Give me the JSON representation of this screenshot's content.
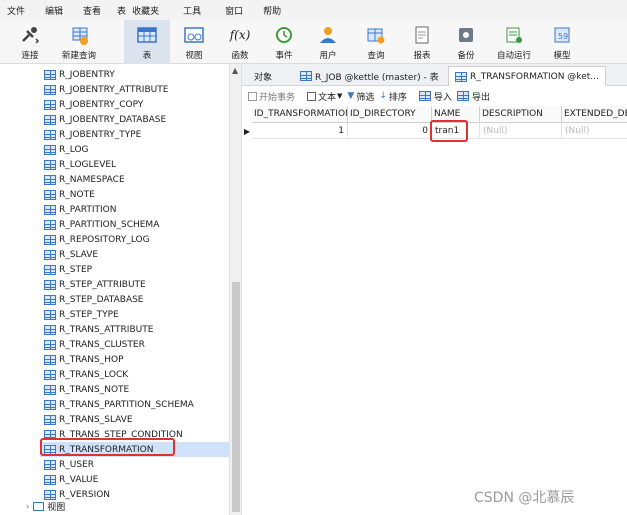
{
  "menu": [
    "文件",
    "编辑",
    "查看",
    "表",
    "收藏夹",
    "工具",
    "窗口",
    "帮助"
  ],
  "toolbar": [
    {
      "label": "连接",
      "icon": "connection-icon"
    },
    {
      "label": "新建查询",
      "icon": "new-query-icon"
    },
    {
      "label": "表",
      "icon": "table-icon",
      "active": true
    },
    {
      "label": "视图",
      "icon": "view-icon"
    },
    {
      "label": "函数",
      "icon": "function-icon",
      "glyph": "f(x)"
    },
    {
      "label": "事件",
      "icon": "event-clock-icon"
    },
    {
      "label": "用户",
      "icon": "user-icon"
    },
    {
      "label": "查询",
      "icon": "query-icon"
    },
    {
      "label": "报表",
      "icon": "report-icon"
    },
    {
      "label": "备份",
      "icon": "backup-icon"
    },
    {
      "label": "自动运行",
      "icon": "auto-run-icon"
    },
    {
      "label": "模型",
      "icon": "model-icon"
    }
  ],
  "tree": {
    "items": [
      "R_JOBENTRY",
      "R_JOBENTRY_ATTRIBUTE",
      "R_JOBENTRY_COPY",
      "R_JOBENTRY_DATABASE",
      "R_JOBENTRY_TYPE",
      "R_LOG",
      "R_LOGLEVEL",
      "R_NAMESPACE",
      "R_NOTE",
      "R_PARTITION",
      "R_PARTITION_SCHEMA",
      "R_REPOSITORY_LOG",
      "R_SLAVE",
      "R_STEP",
      "R_STEP_ATTRIBUTE",
      "R_STEP_DATABASE",
      "R_STEP_TYPE",
      "R_TRANS_ATTRIBUTE",
      "R_TRANS_CLUSTER",
      "R_TRANS_HOP",
      "R_TRANS_LOCK",
      "R_TRANS_NOTE",
      "R_TRANS_PARTITION_SCHEMA",
      "R_TRANS_SLAVE",
      "R_TRANS_STEP_CONDITION",
      "R_TRANSFORMATION",
      "R_USER",
      "R_VALUE",
      "R_VERSION"
    ],
    "selected": "R_TRANSFORMATION",
    "views_node": "视图"
  },
  "tabs": [
    {
      "label": "对象"
    },
    {
      "label": "R_JOB @kettle (master) - 表"
    },
    {
      "label": "R_TRANSFORMATION @ket..."
    }
  ],
  "subtoolbar": {
    "begin_tx": "开始事务",
    "text": "文本",
    "filter": "筛选",
    "sort": "排序",
    "import": "导入",
    "export": "导出"
  },
  "grid": {
    "columns": [
      "ID_TRANSFORMATION",
      "ID_DIRECTORY",
      "NAME",
      "DESCRIPTION",
      "EXTENDED_DE"
    ],
    "rows": [
      {
        "id": "1",
        "dir": "0",
        "name": "tran1",
        "desc": "(Null)",
        "ext": "(Null)"
      }
    ]
  },
  "watermark": "CSDN @北慕辰",
  "colors": {
    "highlight": "#e03030",
    "selection": "#cfe2fa",
    "accent": "#3b77c8"
  }
}
